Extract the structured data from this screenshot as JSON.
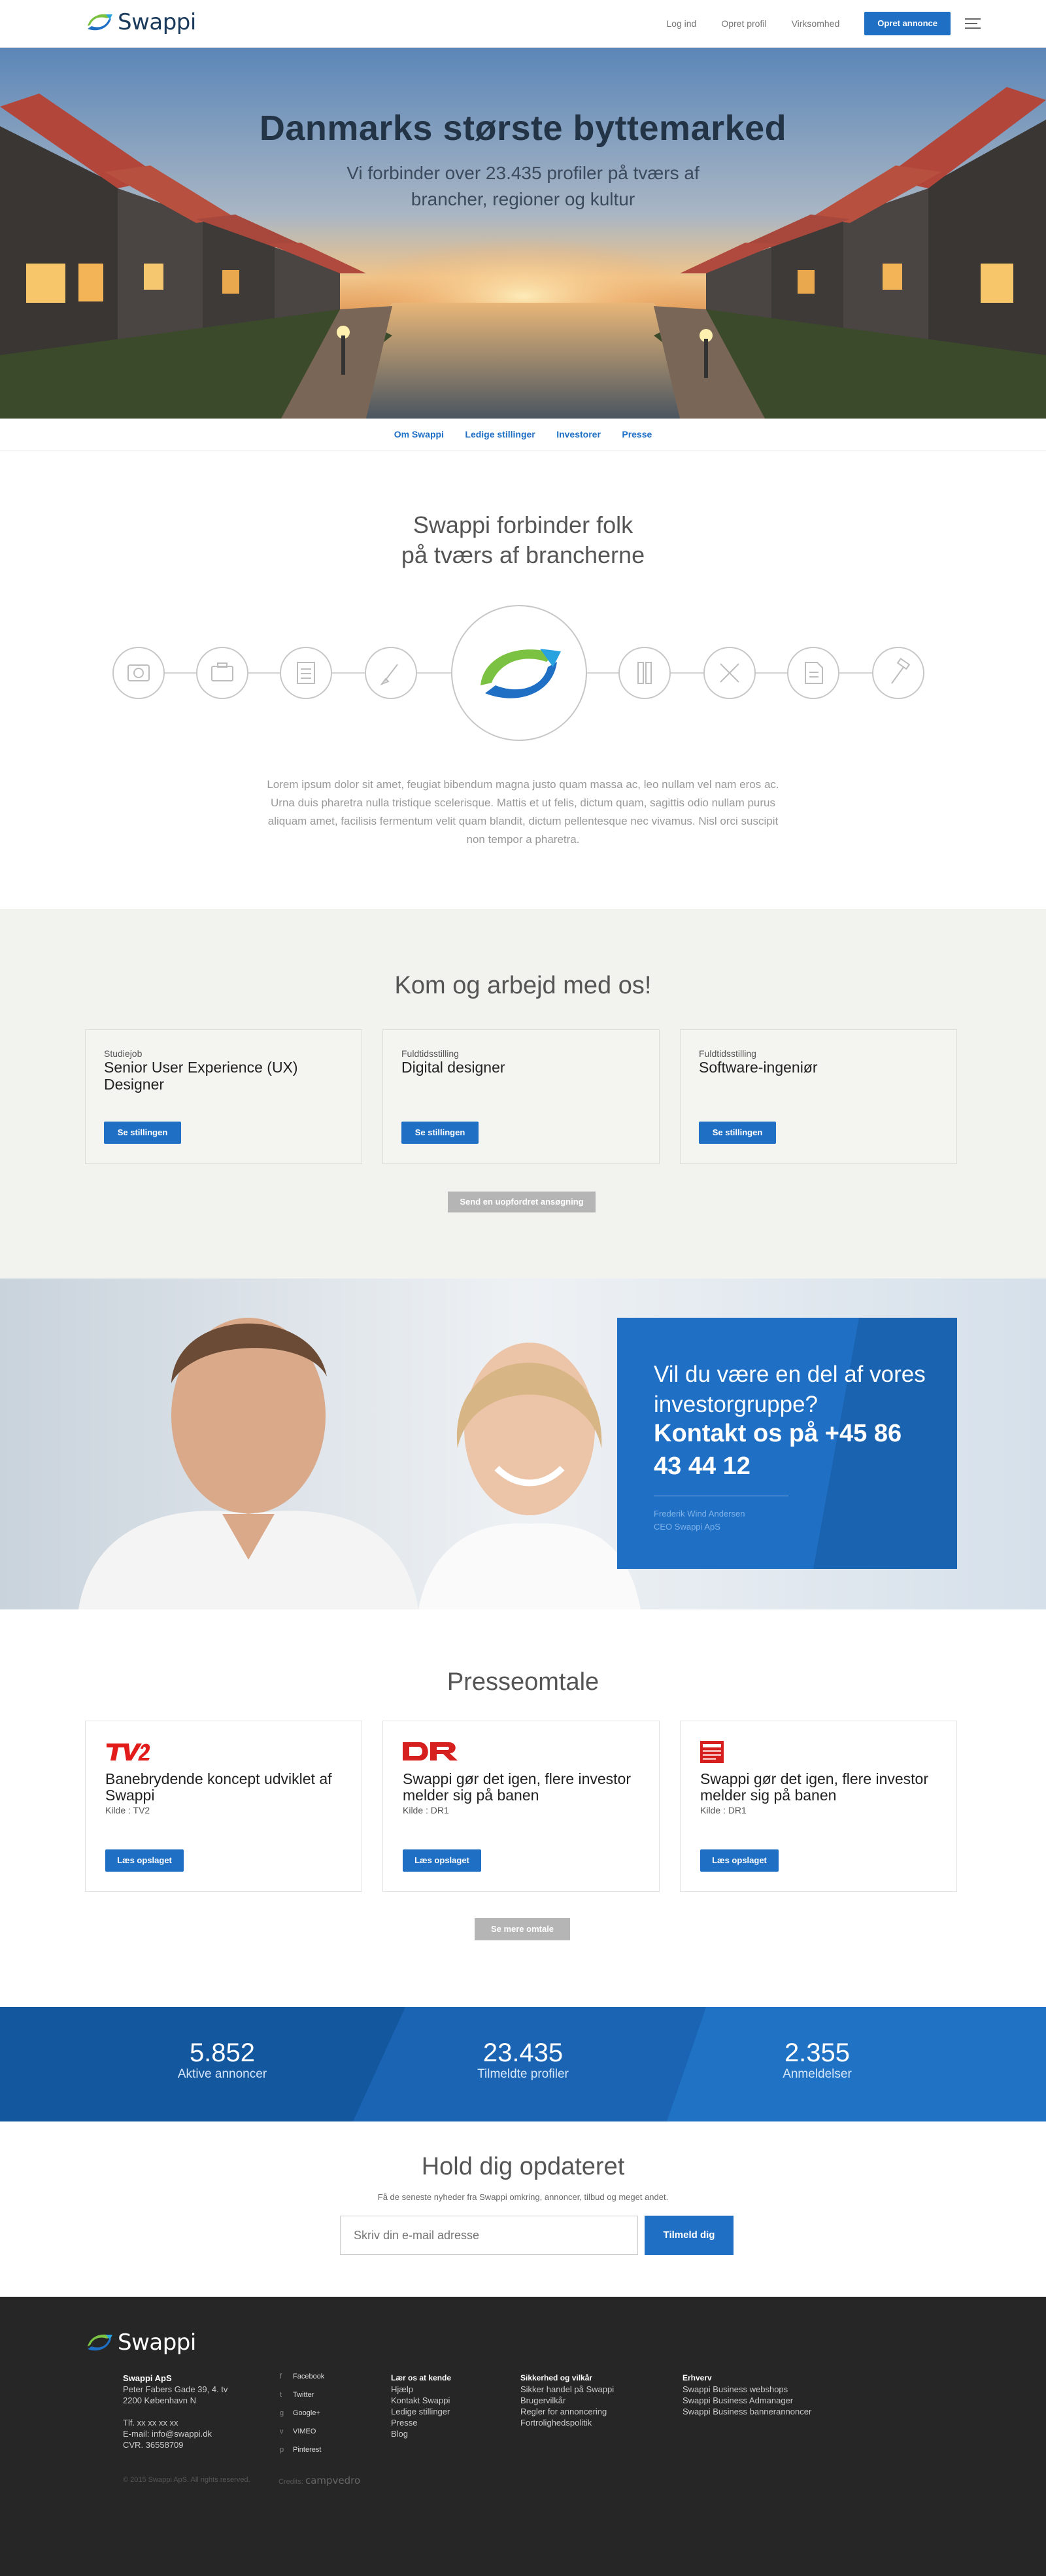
{
  "header": {
    "logo": "Swappi",
    "nav": [
      "Log ind",
      "Opret profil",
      "Virksomhed"
    ],
    "cta": "Opret annonce"
  },
  "hero": {
    "title": "Danmarks største byttemarked",
    "subtitle": "Vi forbinder over 23.435 profiler på tværs af brancher, regioner og kultur"
  },
  "subnav": [
    "Om Swappi",
    "Ledige stillinger",
    "Investorer",
    "Presse"
  ],
  "connect": {
    "title_line1": "Swappi forbinder folk",
    "title_line2": "på tværs af brancherne",
    "icons": [
      "camera-icon",
      "briefcase-icon",
      "document-icon",
      "brush-icon",
      "pencil-ruler-icon",
      "tools-cross-icon",
      "page-icon",
      "hammer-icon"
    ],
    "text": "Lorem ipsum dolor sit amet, feugiat bibendum magna justo quam massa ac, leo nullam vel nam eros ac. Urna duis pharetra nulla tristique scelerisque. Mattis et ut felis, dictum quam, sagittis odio nullam purus aliquam amet, facilisis fermentum velit quam blandit, dictum pellentesque nec vivamus. Nisl orci suscipit non tempor a pharetra."
  },
  "jobs": {
    "title": "Kom og arbejd med os!",
    "cards": [
      {
        "type": "Studiejob",
        "name": "Senior User Experience (UX) Designer",
        "button": "Se stillingen"
      },
      {
        "type": "Fuldtidsstilling",
        "name": "Digital designer",
        "button": "Se stillingen"
      },
      {
        "type": "Fuldtidsstilling",
        "name": "Software-ingeniør",
        "button": "Se stillingen"
      }
    ],
    "unsolicited": "Send en uopfordret ansøgning"
  },
  "investor": {
    "line1": "Vil du være en del af vores investorgruppe?",
    "line2": "Kontakt os på +45 86 43 44 12",
    "name": "Frederik Wind Andersen",
    "role": "CEO Swappi ApS"
  },
  "press": {
    "title": "Presseomtale",
    "cards": [
      {
        "logo": "TV2",
        "headline": "Banebrydende koncept udviklet af Swappi",
        "source": "Kilde : TV2",
        "button": "Læs opslaget"
      },
      {
        "logo": "DR",
        "headline": "Swappi gør det igen, flere investor melder sig på banen",
        "source": "Kilde : DR1",
        "button": "Læs opslaget"
      },
      {
        "logo": "Dansk Dagblad",
        "headline": "Swappi gør det igen, flere investor melder sig på banen",
        "source": "Kilde : DR1",
        "button": "Læs opslaget"
      }
    ],
    "more": "Se mere omtale"
  },
  "stats": [
    {
      "value": "5.852",
      "label": "Aktive annoncer"
    },
    {
      "value": "23.435",
      "label": "Tilmeldte profiler"
    },
    {
      "value": "2.355",
      "label": "Anmeldelser"
    }
  ],
  "newsletter": {
    "title": "Hold dig opdateret",
    "subtitle": "Få de seneste nyheder fra Swappi omkring, annoncer, tilbud og meget andet.",
    "placeholder": "Skriv din e-mail adresse",
    "button": "Tilmeld dig"
  },
  "footer": {
    "logo": "Swappi",
    "company": "Swappi ApS",
    "address1": "Peter Fabers Gade 39, 4. tv",
    "address2": "2200 København N",
    "phone": "Tlf. xx xx xx xx",
    "email": "E-mail: info@swappi.dk",
    "cvr": "CVR. 36558709",
    "social": [
      "Facebook",
      "Twitter",
      "Google+",
      "VIMEO",
      "Pinterest"
    ],
    "col1": {
      "heading": "Lær os at kende",
      "links": [
        "Hjælp",
        "Kontakt Swappi",
        "Ledige stillinger",
        "Presse",
        "Blog"
      ]
    },
    "col2": {
      "heading": "Sikkerhed og vilkår",
      "links": [
        "Sikker handel på Swappi",
        "Brugervilkår",
        "Regler for annoncering",
        "Fortrolighedspolitik"
      ]
    },
    "col3": {
      "heading": "Erhverv",
      "links": [
        "Swappi  Business webshops",
        "Swappi  Business Admanager",
        "Swappi  Business bannerannoncer"
      ]
    },
    "copyright": "© 2015 Swappi ApS. All rights reserved.",
    "credits_label": "Credits:",
    "credits_name": "campvedro"
  }
}
